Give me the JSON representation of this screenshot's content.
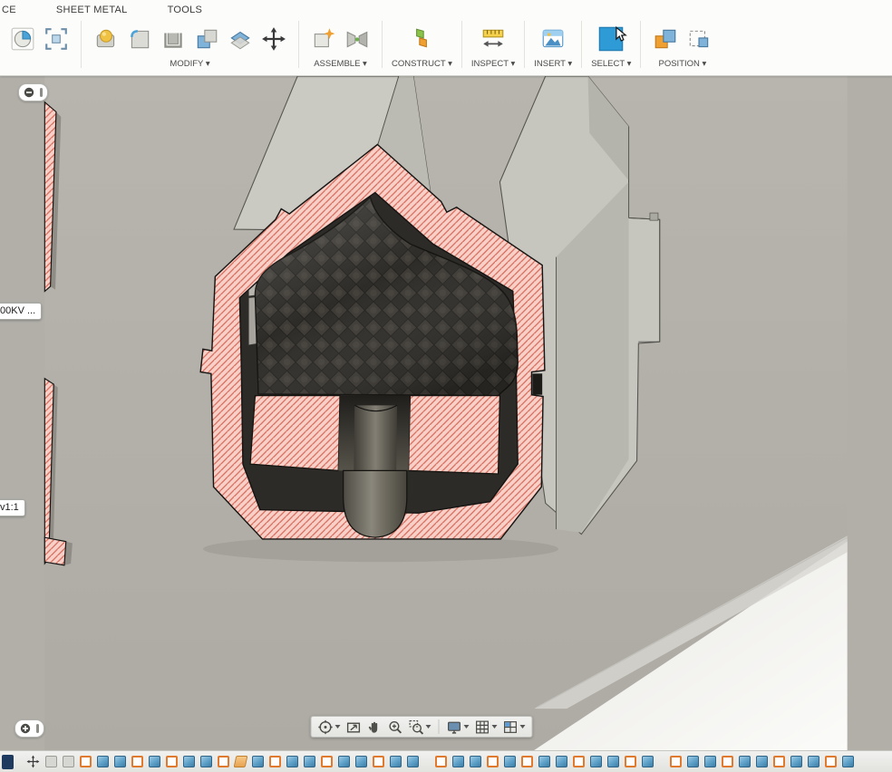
{
  "tabs": [
    "CE",
    "SHEET METAL",
    "TOOLS"
  ],
  "toolbar": {
    "modify": "MODIFY ▾",
    "assemble": "ASSEMBLE ▾",
    "construct": "CONSTRUCT ▾",
    "inspect": "INSPECT ▾",
    "insert": "INSERT ▾",
    "select": "SELECT ▾",
    "position": "POSITION ▾"
  },
  "viewport": {
    "body_label": "00KV ...",
    "view_label": "v1:1"
  },
  "timeline": {
    "features": [
      "sketch",
      "solid",
      "solid",
      "sketch",
      "solid",
      "sketch",
      "solid",
      "solid",
      "sketch",
      "plane",
      "solid",
      "sketch",
      "solid",
      "solid",
      "sketch",
      "solid",
      "solid",
      "sketch",
      "solid",
      "solid",
      "gap",
      "sketch",
      "solid",
      "solid",
      "sketch",
      "solid",
      "sketch",
      "solid",
      "solid",
      "sketch",
      "solid",
      "solid",
      "sketch",
      "solid",
      "gap",
      "sketch",
      "solid",
      "solid",
      "sketch",
      "solid",
      "solid",
      "sketch",
      "solid",
      "solid",
      "sketch",
      "solid"
    ]
  },
  "colors": {
    "section_pink": "#f9d0c7",
    "hatch_line": "#d4695a",
    "select_blue": "#2e9bd6",
    "timeline_orange": "#e07a2e",
    "timeline_blue": "#4d8fb8",
    "body_gray": "#b1afa8"
  }
}
